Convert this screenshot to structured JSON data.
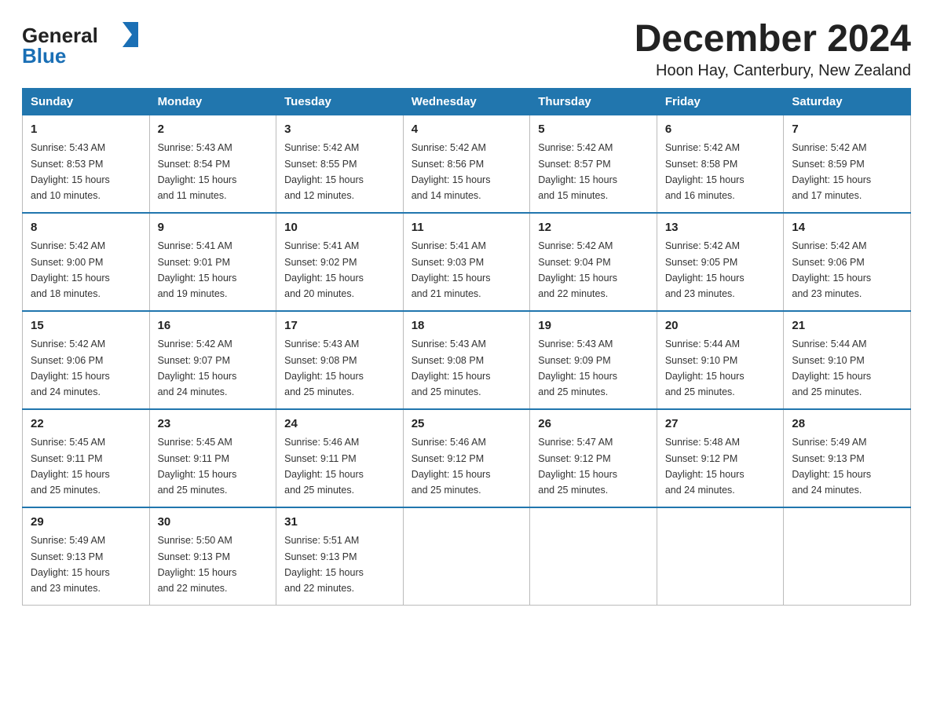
{
  "header": {
    "logo_general": "General",
    "logo_blue": "Blue",
    "month_title": "December 2024",
    "location": "Hoon Hay, Canterbury, New Zealand"
  },
  "weekdays": [
    "Sunday",
    "Monday",
    "Tuesday",
    "Wednesday",
    "Thursday",
    "Friday",
    "Saturday"
  ],
  "weeks": [
    [
      {
        "day": "1",
        "sunrise": "5:43 AM",
        "sunset": "8:53 PM",
        "daylight": "15 hours and 10 minutes."
      },
      {
        "day": "2",
        "sunrise": "5:43 AM",
        "sunset": "8:54 PM",
        "daylight": "15 hours and 11 minutes."
      },
      {
        "day": "3",
        "sunrise": "5:42 AM",
        "sunset": "8:55 PM",
        "daylight": "15 hours and 12 minutes."
      },
      {
        "day": "4",
        "sunrise": "5:42 AM",
        "sunset": "8:56 PM",
        "daylight": "15 hours and 14 minutes."
      },
      {
        "day": "5",
        "sunrise": "5:42 AM",
        "sunset": "8:57 PM",
        "daylight": "15 hours and 15 minutes."
      },
      {
        "day": "6",
        "sunrise": "5:42 AM",
        "sunset": "8:58 PM",
        "daylight": "15 hours and 16 minutes."
      },
      {
        "day": "7",
        "sunrise": "5:42 AM",
        "sunset": "8:59 PM",
        "daylight": "15 hours and 17 minutes."
      }
    ],
    [
      {
        "day": "8",
        "sunrise": "5:42 AM",
        "sunset": "9:00 PM",
        "daylight": "15 hours and 18 minutes."
      },
      {
        "day": "9",
        "sunrise": "5:41 AM",
        "sunset": "9:01 PM",
        "daylight": "15 hours and 19 minutes."
      },
      {
        "day": "10",
        "sunrise": "5:41 AM",
        "sunset": "9:02 PM",
        "daylight": "15 hours and 20 minutes."
      },
      {
        "day": "11",
        "sunrise": "5:41 AM",
        "sunset": "9:03 PM",
        "daylight": "15 hours and 21 minutes."
      },
      {
        "day": "12",
        "sunrise": "5:42 AM",
        "sunset": "9:04 PM",
        "daylight": "15 hours and 22 minutes."
      },
      {
        "day": "13",
        "sunrise": "5:42 AM",
        "sunset": "9:05 PM",
        "daylight": "15 hours and 23 minutes."
      },
      {
        "day": "14",
        "sunrise": "5:42 AM",
        "sunset": "9:06 PM",
        "daylight": "15 hours and 23 minutes."
      }
    ],
    [
      {
        "day": "15",
        "sunrise": "5:42 AM",
        "sunset": "9:06 PM",
        "daylight": "15 hours and 24 minutes."
      },
      {
        "day": "16",
        "sunrise": "5:42 AM",
        "sunset": "9:07 PM",
        "daylight": "15 hours and 24 minutes."
      },
      {
        "day": "17",
        "sunrise": "5:43 AM",
        "sunset": "9:08 PM",
        "daylight": "15 hours and 25 minutes."
      },
      {
        "day": "18",
        "sunrise": "5:43 AM",
        "sunset": "9:08 PM",
        "daylight": "15 hours and 25 minutes."
      },
      {
        "day": "19",
        "sunrise": "5:43 AM",
        "sunset": "9:09 PM",
        "daylight": "15 hours and 25 minutes."
      },
      {
        "day": "20",
        "sunrise": "5:44 AM",
        "sunset": "9:10 PM",
        "daylight": "15 hours and 25 minutes."
      },
      {
        "day": "21",
        "sunrise": "5:44 AM",
        "sunset": "9:10 PM",
        "daylight": "15 hours and 25 minutes."
      }
    ],
    [
      {
        "day": "22",
        "sunrise": "5:45 AM",
        "sunset": "9:11 PM",
        "daylight": "15 hours and 25 minutes."
      },
      {
        "day": "23",
        "sunrise": "5:45 AM",
        "sunset": "9:11 PM",
        "daylight": "15 hours and 25 minutes."
      },
      {
        "day": "24",
        "sunrise": "5:46 AM",
        "sunset": "9:11 PM",
        "daylight": "15 hours and 25 minutes."
      },
      {
        "day": "25",
        "sunrise": "5:46 AM",
        "sunset": "9:12 PM",
        "daylight": "15 hours and 25 minutes."
      },
      {
        "day": "26",
        "sunrise": "5:47 AM",
        "sunset": "9:12 PM",
        "daylight": "15 hours and 25 minutes."
      },
      {
        "day": "27",
        "sunrise": "5:48 AM",
        "sunset": "9:12 PM",
        "daylight": "15 hours and 24 minutes."
      },
      {
        "day": "28",
        "sunrise": "5:49 AM",
        "sunset": "9:13 PM",
        "daylight": "15 hours and 24 minutes."
      }
    ],
    [
      {
        "day": "29",
        "sunrise": "5:49 AM",
        "sunset": "9:13 PM",
        "daylight": "15 hours and 23 minutes."
      },
      {
        "day": "30",
        "sunrise": "5:50 AM",
        "sunset": "9:13 PM",
        "daylight": "15 hours and 22 minutes."
      },
      {
        "day": "31",
        "sunrise": "5:51 AM",
        "sunset": "9:13 PM",
        "daylight": "15 hours and 22 minutes."
      },
      null,
      null,
      null,
      null
    ]
  ],
  "labels": {
    "sunrise": "Sunrise:",
    "sunset": "Sunset:",
    "daylight": "Daylight:"
  }
}
